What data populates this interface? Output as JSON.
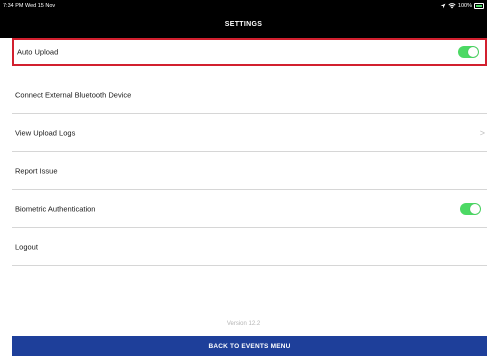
{
  "status_bar": {
    "time": "7:34 PM  Wed 15 Nov",
    "battery": "100%"
  },
  "header": {
    "title": "SETTINGS"
  },
  "settings": [
    {
      "label": "Auto Upload",
      "toggle_on": true
    },
    {
      "label": "Connect External Bluetooth Device"
    },
    {
      "label": "View Upload Logs",
      "chevron": ">"
    },
    {
      "label": "Report Issue"
    },
    {
      "label": "Biometric Authentication",
      "toggle_on": true
    },
    {
      "label": "Logout"
    }
  ],
  "footer": {
    "version": "Version 12.2",
    "back_button": "BACK TO EVENTS MENU"
  },
  "colors": {
    "toggle_on": "#4cd964",
    "button_bg": "#1e3f9a",
    "highlight": "#d2202f"
  }
}
